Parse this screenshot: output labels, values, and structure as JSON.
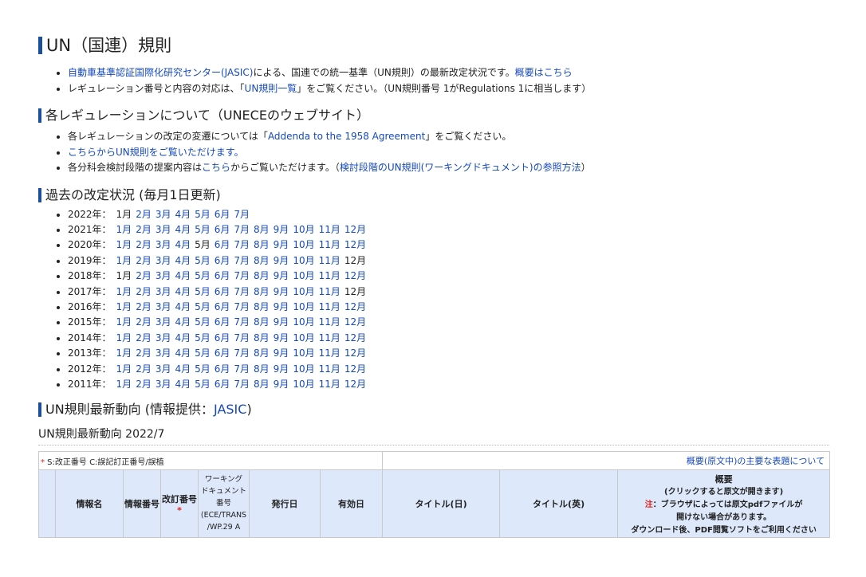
{
  "page_title": "UN（国連）規則",
  "intro": {
    "line1_link": "自動車基準認証国際化研究センター(JASIC)",
    "line1_text": "による、国連での統一基準（UN規則）の最新改定状況です。",
    "line1_link2": "概要はこちら",
    "line2_text1": "レギュレーション番号と内容の対応は、「",
    "line2_link": "UN規則一覧",
    "line2_text2": "」をご覧ください。（UN規則番号 1がRegulations 1に相当します）"
  },
  "unece": {
    "heading": "各レギュレーションについて（UNECEのウェブサイト）",
    "item1_text1": "各レギュレーションの改定の変遷については「",
    "item1_link": "Addenda to the 1958 Agreement",
    "item1_text2": "」をご覧ください。",
    "item2_link": "こちらからUN規則をご覧いただけます。",
    "item3_text1": "各分科会検討段階の提案内容は",
    "item3_link1": "こちら",
    "item3_text2": "からご覧いただけます。（",
    "item3_link2": "検討段階のUN規則(ワーキングドキュメント)の参照方法",
    "item3_text3": "）"
  },
  "history": {
    "heading": "過去の改定状況 (毎月1日更新)",
    "years": [
      {
        "label": "2022年：",
        "months": [
          [
            "1月",
            false
          ],
          [
            "2月",
            true
          ],
          [
            "3月",
            true
          ],
          [
            "4月",
            true
          ],
          [
            "5月",
            true
          ],
          [
            "6月",
            true
          ],
          [
            "7月",
            true
          ]
        ]
      },
      {
        "label": "2021年：",
        "months": [
          [
            "1月",
            true
          ],
          [
            "2月",
            true
          ],
          [
            "3月",
            true
          ],
          [
            "4月",
            true
          ],
          [
            "5月",
            true
          ],
          [
            "6月",
            true
          ],
          [
            "7月",
            true
          ],
          [
            "8月",
            true
          ],
          [
            "9月",
            true
          ],
          [
            "10月",
            true
          ],
          [
            "11月",
            true
          ],
          [
            "12月",
            true
          ]
        ]
      },
      {
        "label": "2020年：",
        "months": [
          [
            "1月",
            true
          ],
          [
            "2月",
            true
          ],
          [
            "3月",
            true
          ],
          [
            "4月",
            true
          ],
          [
            "5月",
            false
          ],
          [
            "6月",
            true
          ],
          [
            "7月",
            true
          ],
          [
            "8月",
            true
          ],
          [
            "9月",
            true
          ],
          [
            "10月",
            true
          ],
          [
            "11月",
            true
          ],
          [
            "12月",
            true
          ]
        ]
      },
      {
        "label": "2019年：",
        "months": [
          [
            "1月",
            true
          ],
          [
            "2月",
            true
          ],
          [
            "3月",
            true
          ],
          [
            "4月",
            true
          ],
          [
            "5月",
            true
          ],
          [
            "6月",
            true
          ],
          [
            "7月",
            true
          ],
          [
            "8月",
            true
          ],
          [
            "9月",
            true
          ],
          [
            "10月",
            true
          ],
          [
            "11月",
            true
          ],
          [
            "12月",
            false
          ]
        ]
      },
      {
        "label": "2018年：",
        "months": [
          [
            "1月",
            false
          ],
          [
            "2月",
            true
          ],
          [
            "3月",
            true
          ],
          [
            "4月",
            true
          ],
          [
            "5月",
            true
          ],
          [
            "6月",
            true
          ],
          [
            "7月",
            true
          ],
          [
            "8月",
            true
          ],
          [
            "9月",
            true
          ],
          [
            "10月",
            true
          ],
          [
            "11月",
            true
          ],
          [
            "12月",
            true
          ]
        ]
      },
      {
        "label": "2017年：",
        "months": [
          [
            "1月",
            true
          ],
          [
            "2月",
            true
          ],
          [
            "3月",
            true
          ],
          [
            "4月",
            true
          ],
          [
            "5月",
            true
          ],
          [
            "6月",
            true
          ],
          [
            "7月",
            true
          ],
          [
            "8月",
            true
          ],
          [
            "9月",
            true
          ],
          [
            "10月",
            true
          ],
          [
            "11月",
            true
          ],
          [
            "12月",
            false
          ]
        ]
      },
      {
        "label": "2016年：",
        "months": [
          [
            "1月",
            true
          ],
          [
            "2月",
            true
          ],
          [
            "3月",
            true
          ],
          [
            "4月",
            true
          ],
          [
            "5月",
            true
          ],
          [
            "6月",
            true
          ],
          [
            "7月",
            true
          ],
          [
            "8月",
            true
          ],
          [
            "9月",
            true
          ],
          [
            "10月",
            true
          ],
          [
            "11月",
            true
          ],
          [
            "12月",
            true
          ]
        ]
      },
      {
        "label": "2015年：",
        "months": [
          [
            "1月",
            true
          ],
          [
            "2月",
            true
          ],
          [
            "3月",
            true
          ],
          [
            "4月",
            true
          ],
          [
            "5月",
            true
          ],
          [
            "6月",
            true
          ],
          [
            "7月",
            true
          ],
          [
            "8月",
            true
          ],
          [
            "9月",
            true
          ],
          [
            "10月",
            true
          ],
          [
            "11月",
            true
          ],
          [
            "12月",
            true
          ]
        ]
      },
      {
        "label": "2014年：",
        "months": [
          [
            "1月",
            true
          ],
          [
            "2月",
            true
          ],
          [
            "3月",
            true
          ],
          [
            "4月",
            true
          ],
          [
            "5月",
            true
          ],
          [
            "6月",
            true
          ],
          [
            "7月",
            true
          ],
          [
            "8月",
            true
          ],
          [
            "9月",
            true
          ],
          [
            "10月",
            true
          ],
          [
            "11月",
            true
          ],
          [
            "12月",
            true
          ]
        ]
      },
      {
        "label": "2013年：",
        "months": [
          [
            "1月",
            true
          ],
          [
            "2月",
            true
          ],
          [
            "3月",
            true
          ],
          [
            "4月",
            true
          ],
          [
            "5月",
            true
          ],
          [
            "6月",
            true
          ],
          [
            "7月",
            true
          ],
          [
            "8月",
            true
          ],
          [
            "9月",
            true
          ],
          [
            "10月",
            true
          ],
          [
            "11月",
            true
          ],
          [
            "12月",
            true
          ]
        ]
      },
      {
        "label": "2012年：",
        "months": [
          [
            "1月",
            true
          ],
          [
            "2月",
            true
          ],
          [
            "3月",
            true
          ],
          [
            "4月",
            true
          ],
          [
            "5月",
            true
          ],
          [
            "6月",
            true
          ],
          [
            "7月",
            true
          ],
          [
            "8月",
            true
          ],
          [
            "9月",
            true
          ],
          [
            "10月",
            true
          ],
          [
            "11月",
            true
          ],
          [
            "12月",
            true
          ]
        ]
      },
      {
        "label": "2011年：",
        "months": [
          [
            "1月",
            true
          ],
          [
            "2月",
            true
          ],
          [
            "3月",
            true
          ],
          [
            "4月",
            true
          ],
          [
            "5月",
            true
          ],
          [
            "6月",
            true
          ],
          [
            "7月",
            true
          ],
          [
            "8月",
            true
          ],
          [
            "9月",
            true
          ],
          [
            "10月",
            true
          ],
          [
            "11月",
            true
          ],
          [
            "12月",
            true
          ]
        ]
      }
    ]
  },
  "latest": {
    "heading_text": "UN規則最新動向 (情報提供：",
    "heading_link": "JASIC",
    "heading_close": ")",
    "subtitle": "UN規則最新動向 2022/7"
  },
  "table": {
    "note_star": "*",
    "note": " S:改正番号 C:誤記訂正番号/誤植",
    "summary_link": "概要(原文中)の主要な表題について",
    "headers": {
      "info_name": "情報名",
      "info_no": "情報番号",
      "rev_no": "改訂番号",
      "rev_star": "*",
      "wd_line1": "ワーキング",
      "wd_line2": "ドキュメント",
      "wd_line3": "番号",
      "wd_line4": "(ECE/TRANS",
      "wd_line5": "/WP.29 A",
      "issue_date": "発行日",
      "effective_date": "有効日",
      "title_ja": "タイトル(日)",
      "title_en": "タイトル(英)",
      "sum_title": "概要",
      "sum_line1": "(クリックすると原文が開きます)",
      "sum_warn": "注",
      "sum_line2": "：ブラウザによっては原文pdfファイルが",
      "sum_line3": "開けない場合があります。",
      "sum_line4": "ダウンロード後、PDF閲覧ソフトをご利用ください"
    }
  },
  "colors": {
    "accent": "#1a4f9c",
    "link": "#1548c0",
    "header_bg": "#dde9fb",
    "alert": "#e0201f"
  }
}
